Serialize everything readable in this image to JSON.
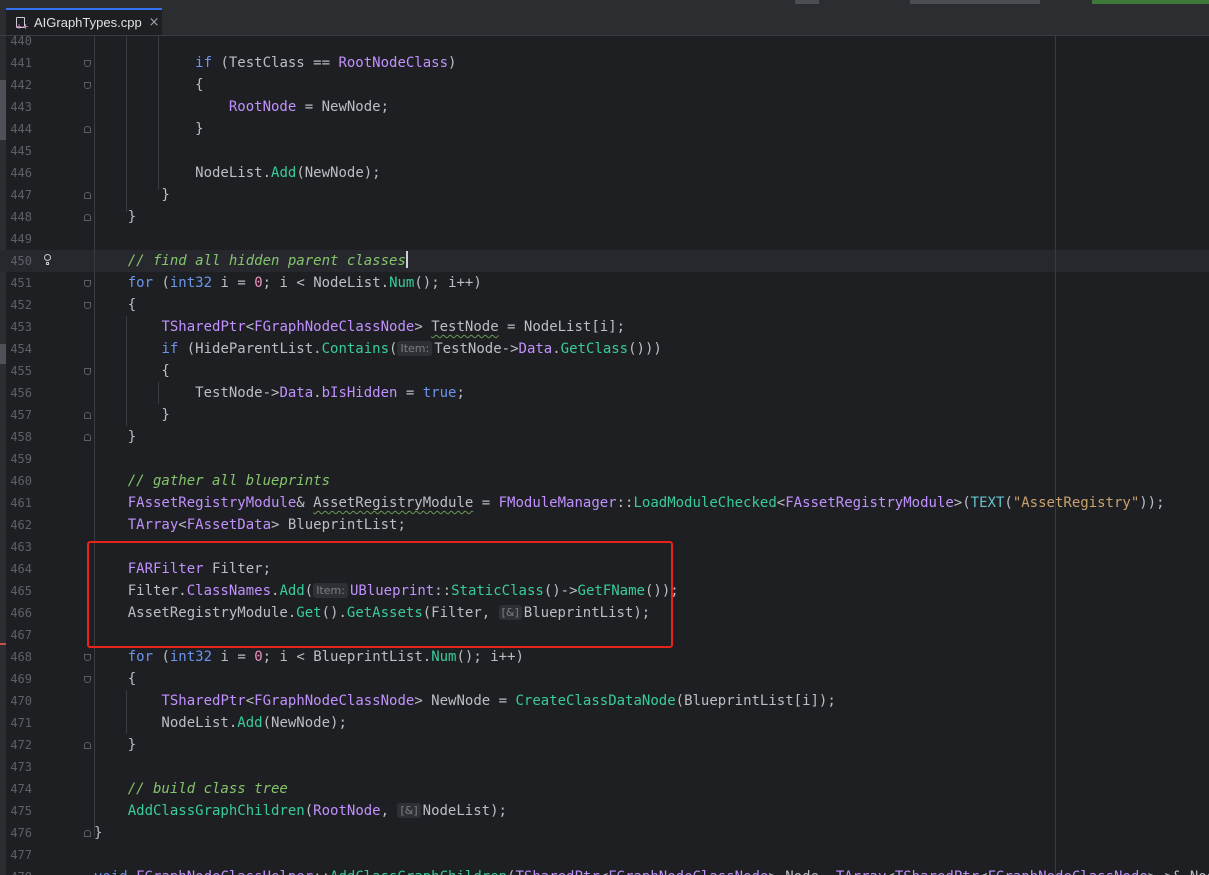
{
  "tab": {
    "filename": "AIGraphTypes.cpp",
    "close": "×"
  },
  "editor": {
    "current_line": 450,
    "lines": [
      {
        "n": "440",
        "html": ""
      },
      {
        "n": "441",
        "html": "            <span class=\"kw\">if</span> (TestClass == <span class=\"ty\">RootNodeClass</span>)"
      },
      {
        "n": "442",
        "html": "            {"
      },
      {
        "n": "443",
        "html": "                <span class=\"ty\">RootNode</span> = NewNode;"
      },
      {
        "n": "444",
        "html": "            }"
      },
      {
        "n": "445",
        "html": ""
      },
      {
        "n": "446",
        "html": "            NodeList.<span class=\"fn\">Add</span>(NewNode);"
      },
      {
        "n": "447",
        "html": "        }"
      },
      {
        "n": "448",
        "html": "    }"
      },
      {
        "n": "449",
        "html": ""
      },
      {
        "n": "450",
        "html": "    <span class=\"cm\">// find all hidden parent classes</span><span class=\"caret\"></span>"
      },
      {
        "n": "451",
        "html": "    <span class=\"kw\">for</span> (<span class=\"kw\">int32</span> i = <span class=\"num\">0</span>; i &lt; NodeList.<span class=\"fn\">Num</span>(); i++)"
      },
      {
        "n": "452",
        "html": "    {"
      },
      {
        "n": "453",
        "html": "        <span class=\"ty\">TSharedPtr</span>&lt;<span class=\"ty\">FGraphNodeClassNode</span>&gt; <span class=\"squig\">TestNode</span> = NodeList[i];"
      },
      {
        "n": "454",
        "html": "        <span class=\"kw\">if</span> (HideParentList.<span class=\"fn\">Contains</span>(<span class=\"hint\">Item:</span>TestNode<span class=\"ar\">-&gt;</span><span class=\"ty\">Data</span>.<span class=\"fn\">GetClass</span>()))"
      },
      {
        "n": "455",
        "html": "        {"
      },
      {
        "n": "456",
        "html": "            TestNode<span class=\"ar\">-&gt;</span><span class=\"ty\">Data</span>.<span class=\"ty\">bIsHidden</span> = <span class=\"kw\">true</span>;"
      },
      {
        "n": "457",
        "html": "        }"
      },
      {
        "n": "458",
        "html": "    }"
      },
      {
        "n": "459",
        "html": ""
      },
      {
        "n": "460",
        "html": "    <span class=\"cm\">// gather all blueprints</span>"
      },
      {
        "n": "461",
        "html": "    <span class=\"ty\">FAssetRegistryModule</span>&amp; <span class=\"squig\">AssetRegistryModule</span> = <span class=\"ty\">FModuleManager</span>::<span class=\"fn\">LoadModuleChecked</span>&lt;<span class=\"ty\">FAssetRegistryModule</span>&gt;(<span class=\"mf\">TEXT</span>(<span class=\"st\">\"AssetRegistry\"</span>));"
      },
      {
        "n": "462",
        "html": "    <span class=\"ty\">TArray</span>&lt;<span class=\"ty\">FAssetData</span>&gt; BlueprintList;"
      },
      {
        "n": "463",
        "html": ""
      },
      {
        "n": "464",
        "html": "    <span class=\"ty\">FARFilter</span> Filter;"
      },
      {
        "n": "465",
        "html": "    Filter.<span class=\"ty\">ClassNames</span>.<span class=\"fn\">Add</span>(<span class=\"hint\">Item:</span><span class=\"ty\">UBlueprint</span>::<span class=\"fn\">StaticClass</span>()<span class=\"ar\">-&gt;</span><span class=\"fn\">GetFName</span>());"
      },
      {
        "n": "466",
        "html": "    AssetRegistryModule.<span class=\"fn\">Get</span>().<span class=\"fn\">GetAssets</span>(Filter, <span class=\"hint\">[&amp;]</span>BlueprintList);"
      },
      {
        "n": "467",
        "html": ""
      },
      {
        "n": "468",
        "html": "    <span class=\"kw\">for</span> (<span class=\"kw\">int32</span> i = <span class=\"num\">0</span>; i &lt; BlueprintList.<span class=\"fn\">Num</span>(); i++)"
      },
      {
        "n": "469",
        "html": "    {"
      },
      {
        "n": "470",
        "html": "        <span class=\"ty\">TSharedPtr</span>&lt;<span class=\"ty\">FGraphNodeClassNode</span>&gt; NewNode = <span class=\"fn\">CreateClassDataNode</span>(BlueprintList[i]);"
      },
      {
        "n": "471",
        "html": "        NodeList.<span class=\"fn\">Add</span>(NewNode);"
      },
      {
        "n": "472",
        "html": "    }"
      },
      {
        "n": "473",
        "html": ""
      },
      {
        "n": "474",
        "html": "    <span class=\"cm\">// build class tree</span>"
      },
      {
        "n": "475",
        "html": "    <span class=\"fn\">AddClassGraphChildren</span>(<span class=\"ty\">RootNode</span>, <span class=\"hint\">[&amp;]</span>NodeList);"
      },
      {
        "n": "476",
        "html": "}"
      },
      {
        "n": "477",
        "html": ""
      },
      {
        "n": "478",
        "html": "<span class=\"kw\">void</span> <span class=\"ty\">FGraphNodeClassHelper</span>::<span class=\"fn\">AddClassGraphChildren</span>(<span class=\"ty\">TSharedPtr</span>&lt;<span class=\"ty\">FGraphNodeClassNode</span>&gt; Node, <span class=\"ty\">TArray</span>&lt;<span class=\"ty\">TSharedPtr</span>&lt;<span class=\"ty\">FGraphNodeClassNode</span>&gt; &gt;&amp; NodeList)"
      }
    ]
  },
  "annotation": {
    "highlight_lines": "464-467",
    "color": "#e8241a"
  },
  "colors": {
    "background": "#1e1f22",
    "keyword": "#6c95eb",
    "type": "#c191ff",
    "function": "#39cc9b",
    "comment": "#85c46c",
    "string": "#c9a26d",
    "number": "#ed94c0"
  }
}
